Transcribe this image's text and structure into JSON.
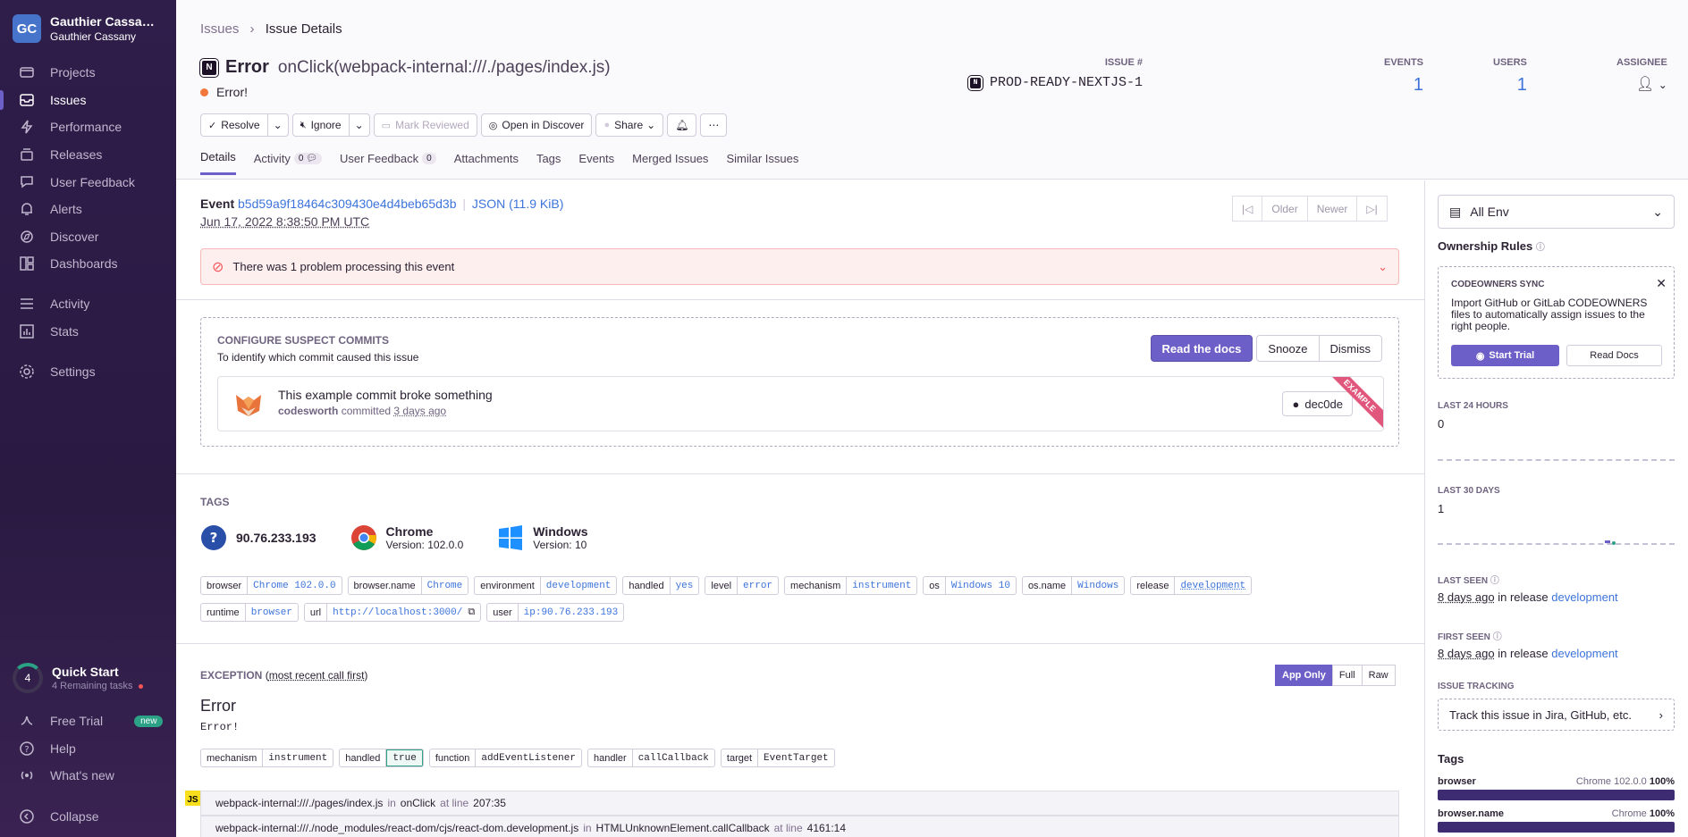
{
  "sidebar": {
    "org_initials": "GC",
    "org_name": "Gauthier Cassa…",
    "user_name": "Gauthier Cassany",
    "items": [
      {
        "label": "Projects",
        "icon": "projects-icon"
      },
      {
        "label": "Issues",
        "icon": "issues-icon"
      },
      {
        "label": "Performance",
        "icon": "performance-icon"
      },
      {
        "label": "Releases",
        "icon": "releases-icon"
      },
      {
        "label": "User Feedback",
        "icon": "feedback-icon"
      },
      {
        "label": "Alerts",
        "icon": "alerts-icon"
      },
      {
        "label": "Discover",
        "icon": "discover-icon"
      },
      {
        "label": "Dashboards",
        "icon": "dashboards-icon"
      }
    ],
    "items2": [
      {
        "label": "Activity",
        "icon": "activity-icon"
      },
      {
        "label": "Stats",
        "icon": "stats-icon"
      }
    ],
    "settings": "Settings",
    "quick_start": {
      "count": "4",
      "title": "Quick Start",
      "sub": "4 Remaining tasks"
    },
    "free_trial": "Free Trial",
    "new_badge": "new",
    "help": "Help",
    "whats_new": "What's new",
    "collapse": "Collapse"
  },
  "header": {
    "breadcrumb_root": "Issues",
    "breadcrumb_current": "Issue Details",
    "platform_icon_text": "N",
    "title_type": "Error",
    "title_location": "onClick(webpack-internal:///./pages/index.js)",
    "subtitle": "Error!",
    "stats": {
      "issue_label": "ISSUE #",
      "issue_id": "PROD-READY-NEXTJS-1",
      "events_label": "EVENTS",
      "events": "1",
      "users_label": "USERS",
      "users": "1",
      "assignee_label": "ASSIGNEE"
    },
    "actions": {
      "resolve": "Resolve",
      "ignore": "Ignore",
      "mark_reviewed": "Mark Reviewed",
      "open_discover": "Open in Discover",
      "share": "Share"
    },
    "tabs": [
      {
        "label": "Details"
      },
      {
        "label": "Activity",
        "count": "0"
      },
      {
        "label": "User Feedback",
        "count": "0"
      },
      {
        "label": "Attachments"
      },
      {
        "label": "Tags"
      },
      {
        "label": "Events"
      },
      {
        "label": "Merged Issues"
      },
      {
        "label": "Similar Issues"
      }
    ]
  },
  "event": {
    "label": "Event",
    "id": "b5d59a9f18464c309430e4d4beb65d3b",
    "json": "JSON (11.9 KiB)",
    "date": "Jun 17, 2022 8:38:50 PM UTC",
    "older": "Older",
    "newer": "Newer",
    "alert": "There was 1 problem processing this event"
  },
  "commits": {
    "heading": "CONFIGURE SUSPECT COMMITS",
    "sub": "To identify which commit caused this issue",
    "read_docs": "Read the docs",
    "snooze": "Snooze",
    "dismiss": "Dismiss",
    "commit_title": "This example commit broke something",
    "author": "codesworth",
    "committed": "committed",
    "when": "3 days ago",
    "sha": "dec0de",
    "ribbon": "EXAMPLE"
  },
  "tags": {
    "heading": "TAGS",
    "highlights": {
      "ip": "90.76.233.193",
      "browser": "Chrome",
      "browser_version": "Version: 102.0.0",
      "os": "Windows",
      "os_version": "Version: 10"
    },
    "row1": [
      {
        "k": "browser",
        "v": "Chrome 102.0.0"
      },
      {
        "k": "browser.name",
        "v": "Chrome"
      },
      {
        "k": "environment",
        "v": "development"
      },
      {
        "k": "handled",
        "v": "yes"
      },
      {
        "k": "level",
        "v": "error"
      },
      {
        "k": "mechanism",
        "v": "instrument"
      },
      {
        "k": "os",
        "v": "Windows 10"
      },
      {
        "k": "os.name",
        "v": "Windows"
      },
      {
        "k": "release",
        "v": "development"
      }
    ],
    "row2": [
      {
        "k": "runtime",
        "v": "browser"
      },
      {
        "k": "url",
        "v": "http://localhost:3000/"
      },
      {
        "k": "user",
        "v": "ip:90.76.233.193"
      }
    ]
  },
  "exception": {
    "heading": "EXCEPTION",
    "heading_note": "most recent call first",
    "app_only": "App Only",
    "full": "Full",
    "raw": "Raw",
    "type": "Error",
    "value": "Error!",
    "mech": [
      {
        "k": "mechanism",
        "v": "instrument"
      },
      {
        "k": "handled",
        "v": "true"
      },
      {
        "k": "function",
        "v": "addEventListener"
      },
      {
        "k": "handler",
        "v": "callCallback"
      },
      {
        "k": "target",
        "v": "EventTarget"
      }
    ],
    "frames": [
      {
        "file": "webpack-internal:///./pages/index.js",
        "in": "in",
        "fn": "onClick",
        "at": "at line",
        "line": "207:35"
      },
      {
        "file": "webpack-internal:///./node_modules/react-dom/cjs/react-dom.development.js",
        "in": "in",
        "fn": "HTMLUnknownElement.callCallback",
        "at": "at line",
        "line": "4161:14"
      }
    ],
    "js_badge": "JS"
  },
  "side": {
    "env": "All Env",
    "ownership": "Ownership Rules",
    "codeowners_h": "CODEOWNERS SYNC",
    "codeowners_t": "Import GitHub or GitLab CODEOWNERS files to automatically assign issues to the right people.",
    "start_trial": "Start Trial",
    "read_docs": "Read Docs",
    "last24_h": "LAST 24 HOURS",
    "last24_v": "0",
    "last30_h": "LAST 30 DAYS",
    "last30_v": "1",
    "last_seen_h": "LAST SEEN",
    "last_seen_v": "8 days ago",
    "first_seen_h": "FIRST SEEN",
    "first_seen_v": "8 days ago",
    "in_release": "in release",
    "release": "development",
    "tracking_h": "ISSUE TRACKING",
    "tracking_t": "Track this issue in Jira, GitHub, etc.",
    "tags_h": "Tags",
    "tag_bars": [
      {
        "k": "browser",
        "v": "Chrome 102.0.0",
        "pct": "100%"
      },
      {
        "k": "browser.name",
        "v": "Chrome",
        "pct": "100%"
      }
    ]
  }
}
